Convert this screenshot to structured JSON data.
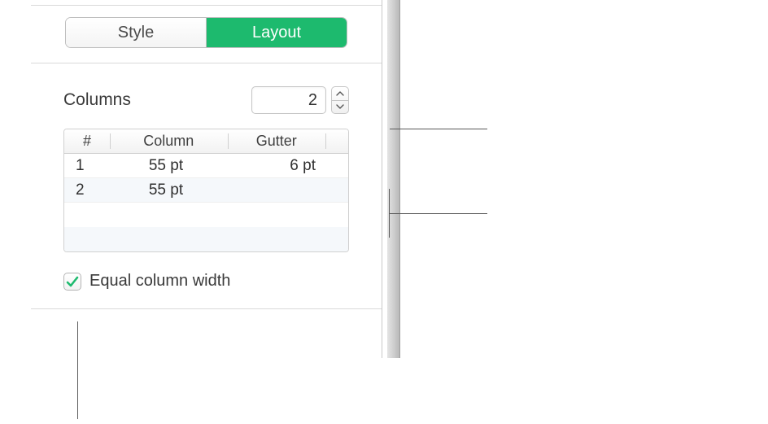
{
  "tabs": {
    "style": "Style",
    "layout": "Layout"
  },
  "columns": {
    "label": "Columns",
    "value": "2"
  },
  "table": {
    "headers": {
      "num": "#",
      "column": "Column",
      "gutter": "Gutter"
    },
    "rows": [
      {
        "num": "1",
        "column": "55 pt",
        "gutter": "6 pt"
      },
      {
        "num": "2",
        "column": "55 pt",
        "gutter": ""
      }
    ]
  },
  "equalWidth": {
    "label": "Equal column width",
    "checked": true
  },
  "colors": {
    "accent": "#1dba6e"
  }
}
